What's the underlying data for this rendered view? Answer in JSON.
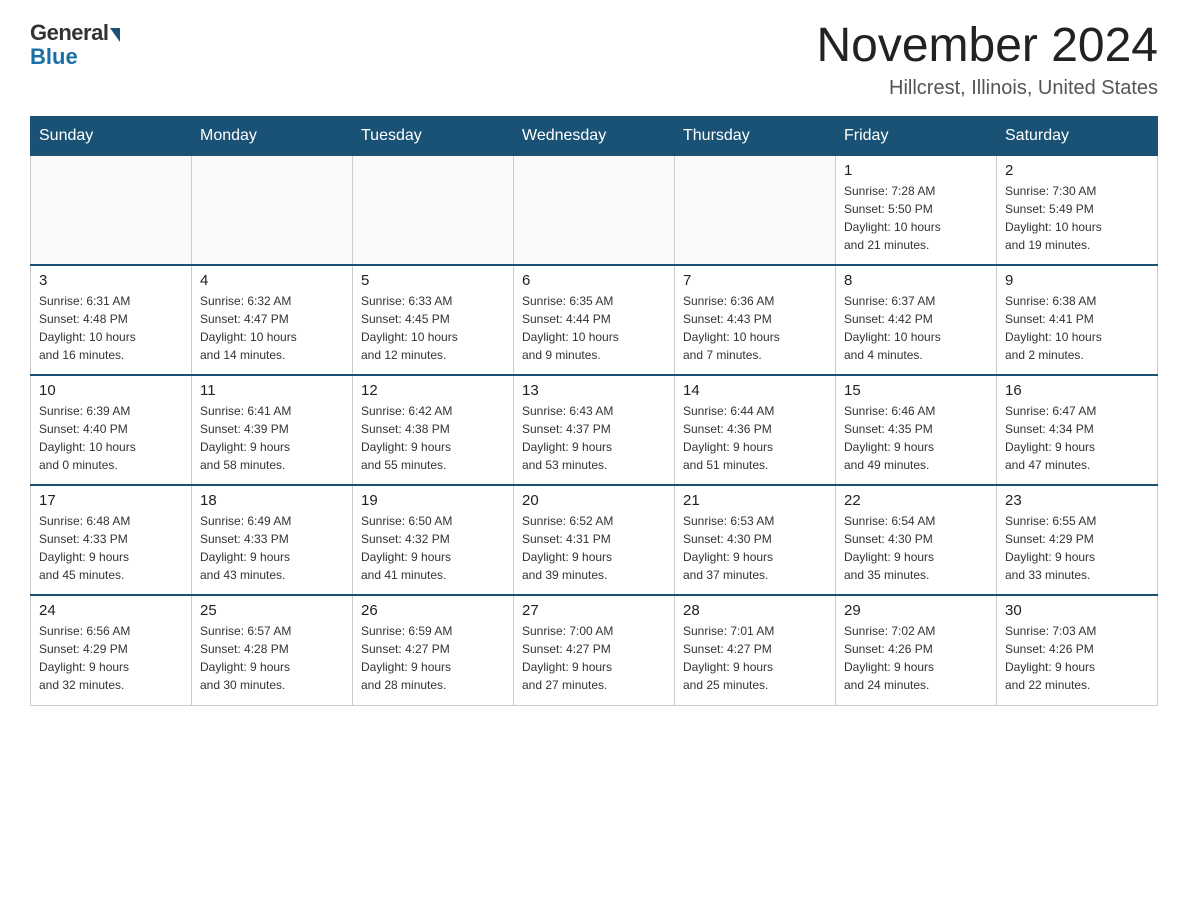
{
  "header": {
    "logo_general": "General",
    "logo_blue": "Blue",
    "month_title": "November 2024",
    "location": "Hillcrest, Illinois, United States"
  },
  "days_of_week": [
    "Sunday",
    "Monday",
    "Tuesday",
    "Wednesday",
    "Thursday",
    "Friday",
    "Saturday"
  ],
  "weeks": [
    [
      {
        "day": "",
        "info": ""
      },
      {
        "day": "",
        "info": ""
      },
      {
        "day": "",
        "info": ""
      },
      {
        "day": "",
        "info": ""
      },
      {
        "day": "",
        "info": ""
      },
      {
        "day": "1",
        "info": "Sunrise: 7:28 AM\nSunset: 5:50 PM\nDaylight: 10 hours\nand 21 minutes."
      },
      {
        "day": "2",
        "info": "Sunrise: 7:30 AM\nSunset: 5:49 PM\nDaylight: 10 hours\nand 19 minutes."
      }
    ],
    [
      {
        "day": "3",
        "info": "Sunrise: 6:31 AM\nSunset: 4:48 PM\nDaylight: 10 hours\nand 16 minutes."
      },
      {
        "day": "4",
        "info": "Sunrise: 6:32 AM\nSunset: 4:47 PM\nDaylight: 10 hours\nand 14 minutes."
      },
      {
        "day": "5",
        "info": "Sunrise: 6:33 AM\nSunset: 4:45 PM\nDaylight: 10 hours\nand 12 minutes."
      },
      {
        "day": "6",
        "info": "Sunrise: 6:35 AM\nSunset: 4:44 PM\nDaylight: 10 hours\nand 9 minutes."
      },
      {
        "day": "7",
        "info": "Sunrise: 6:36 AM\nSunset: 4:43 PM\nDaylight: 10 hours\nand 7 minutes."
      },
      {
        "day": "8",
        "info": "Sunrise: 6:37 AM\nSunset: 4:42 PM\nDaylight: 10 hours\nand 4 minutes."
      },
      {
        "day": "9",
        "info": "Sunrise: 6:38 AM\nSunset: 4:41 PM\nDaylight: 10 hours\nand 2 minutes."
      }
    ],
    [
      {
        "day": "10",
        "info": "Sunrise: 6:39 AM\nSunset: 4:40 PM\nDaylight: 10 hours\nand 0 minutes."
      },
      {
        "day": "11",
        "info": "Sunrise: 6:41 AM\nSunset: 4:39 PM\nDaylight: 9 hours\nand 58 minutes."
      },
      {
        "day": "12",
        "info": "Sunrise: 6:42 AM\nSunset: 4:38 PM\nDaylight: 9 hours\nand 55 minutes."
      },
      {
        "day": "13",
        "info": "Sunrise: 6:43 AM\nSunset: 4:37 PM\nDaylight: 9 hours\nand 53 minutes."
      },
      {
        "day": "14",
        "info": "Sunrise: 6:44 AM\nSunset: 4:36 PM\nDaylight: 9 hours\nand 51 minutes."
      },
      {
        "day": "15",
        "info": "Sunrise: 6:46 AM\nSunset: 4:35 PM\nDaylight: 9 hours\nand 49 minutes."
      },
      {
        "day": "16",
        "info": "Sunrise: 6:47 AM\nSunset: 4:34 PM\nDaylight: 9 hours\nand 47 minutes."
      }
    ],
    [
      {
        "day": "17",
        "info": "Sunrise: 6:48 AM\nSunset: 4:33 PM\nDaylight: 9 hours\nand 45 minutes."
      },
      {
        "day": "18",
        "info": "Sunrise: 6:49 AM\nSunset: 4:33 PM\nDaylight: 9 hours\nand 43 minutes."
      },
      {
        "day": "19",
        "info": "Sunrise: 6:50 AM\nSunset: 4:32 PM\nDaylight: 9 hours\nand 41 minutes."
      },
      {
        "day": "20",
        "info": "Sunrise: 6:52 AM\nSunset: 4:31 PM\nDaylight: 9 hours\nand 39 minutes."
      },
      {
        "day": "21",
        "info": "Sunrise: 6:53 AM\nSunset: 4:30 PM\nDaylight: 9 hours\nand 37 minutes."
      },
      {
        "day": "22",
        "info": "Sunrise: 6:54 AM\nSunset: 4:30 PM\nDaylight: 9 hours\nand 35 minutes."
      },
      {
        "day": "23",
        "info": "Sunrise: 6:55 AM\nSunset: 4:29 PM\nDaylight: 9 hours\nand 33 minutes."
      }
    ],
    [
      {
        "day": "24",
        "info": "Sunrise: 6:56 AM\nSunset: 4:29 PM\nDaylight: 9 hours\nand 32 minutes."
      },
      {
        "day": "25",
        "info": "Sunrise: 6:57 AM\nSunset: 4:28 PM\nDaylight: 9 hours\nand 30 minutes."
      },
      {
        "day": "26",
        "info": "Sunrise: 6:59 AM\nSunset: 4:27 PM\nDaylight: 9 hours\nand 28 minutes."
      },
      {
        "day": "27",
        "info": "Sunrise: 7:00 AM\nSunset: 4:27 PM\nDaylight: 9 hours\nand 27 minutes."
      },
      {
        "day": "28",
        "info": "Sunrise: 7:01 AM\nSunset: 4:27 PM\nDaylight: 9 hours\nand 25 minutes."
      },
      {
        "day": "29",
        "info": "Sunrise: 7:02 AM\nSunset: 4:26 PM\nDaylight: 9 hours\nand 24 minutes."
      },
      {
        "day": "30",
        "info": "Sunrise: 7:03 AM\nSunset: 4:26 PM\nDaylight: 9 hours\nand 22 minutes."
      }
    ]
  ]
}
